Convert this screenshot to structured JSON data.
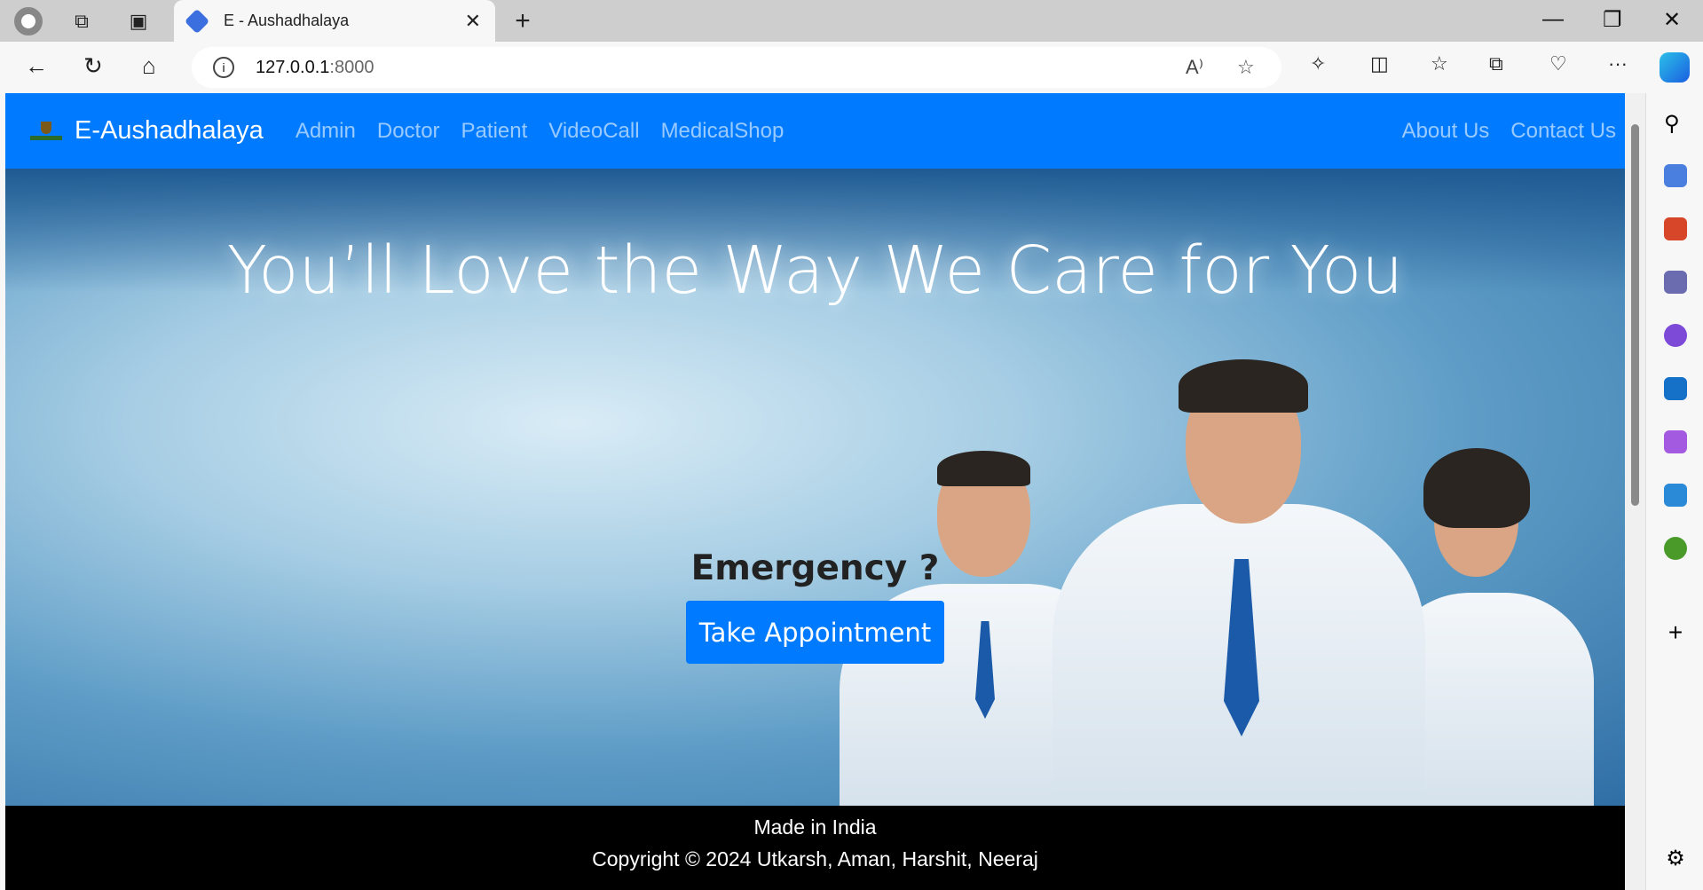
{
  "browser": {
    "tab_title": "E - Aushadhalaya",
    "url_host": "127.0.0.1",
    "url_port": ":8000"
  },
  "navbar": {
    "brand": "E-Aushadhalaya",
    "links": [
      "Admin",
      "Doctor",
      "Patient",
      "VideoCall",
      "MedicalShop"
    ],
    "right_links": [
      "About Us",
      "Contact Us"
    ],
    "color": "#007bff"
  },
  "hero": {
    "title": "You’ll Love the Way We Care for You",
    "emergency": "Emergency ?",
    "button": "Take Appointment"
  },
  "footer": {
    "line1": "Made in India",
    "line2": "Copyright © 2024 Utkarsh, Aman, Harshit, Neeraj"
  }
}
